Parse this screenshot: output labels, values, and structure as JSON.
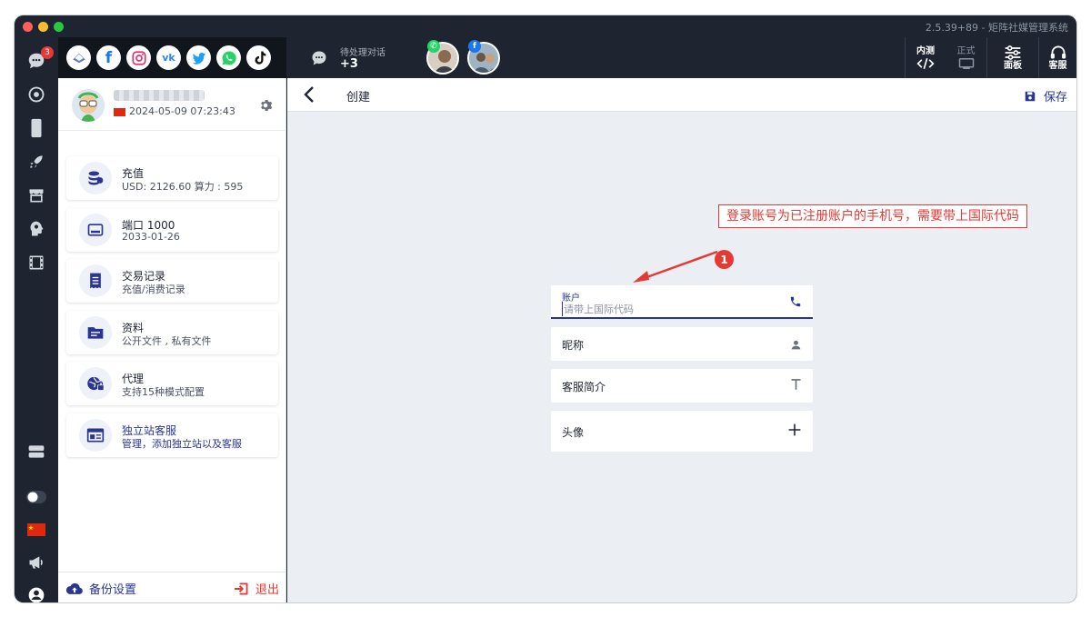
{
  "window": {
    "title": "2.5.39+89 - 矩阵社媒管理系统"
  },
  "rail": {
    "badge_count": "3"
  },
  "topbar": {
    "pending_label": "待处理对话",
    "pending_count": "+3",
    "tools": {
      "internal_test": "内测",
      "official": "正式",
      "panel": "面板",
      "support": "客服"
    }
  },
  "profile": {
    "date": "2024-05-09 07:23:43"
  },
  "cards": [
    {
      "title": "充值",
      "subtitle": "USD: 2126.60  算力 : 595",
      "icon": "coins-icon"
    },
    {
      "title": "端口 1000",
      "subtitle": "2033-01-26",
      "icon": "port-icon"
    },
    {
      "title": "交易记录",
      "subtitle": "充值/消费记录",
      "icon": "receipt-icon"
    },
    {
      "title": "资料",
      "subtitle": "公开文件 , 私有文件",
      "icon": "folder-icon"
    },
    {
      "title": "代理",
      "subtitle": "支持15种模式配置",
      "icon": "proxy-globe-icon"
    },
    {
      "title": "独立站客服",
      "subtitle": "管理，添加独立站以及客服",
      "icon": "website-icon"
    }
  ],
  "footer": {
    "backup_label": "备份设置",
    "logout_label": "退出"
  },
  "main": {
    "title": "创建",
    "save_label": "保存",
    "callout_text": "登录账号为已注册账户的手机号，需要带上国际代码",
    "step_number": "1",
    "account": {
      "label": "账户",
      "placeholder": "请带上国际代码"
    },
    "nickname_label": "昵称",
    "intro_label": "客服简介",
    "avatar_label": "头像"
  },
  "colors": {
    "accent": "#283593",
    "danger": "#e53935",
    "dark": "#1e2530"
  }
}
